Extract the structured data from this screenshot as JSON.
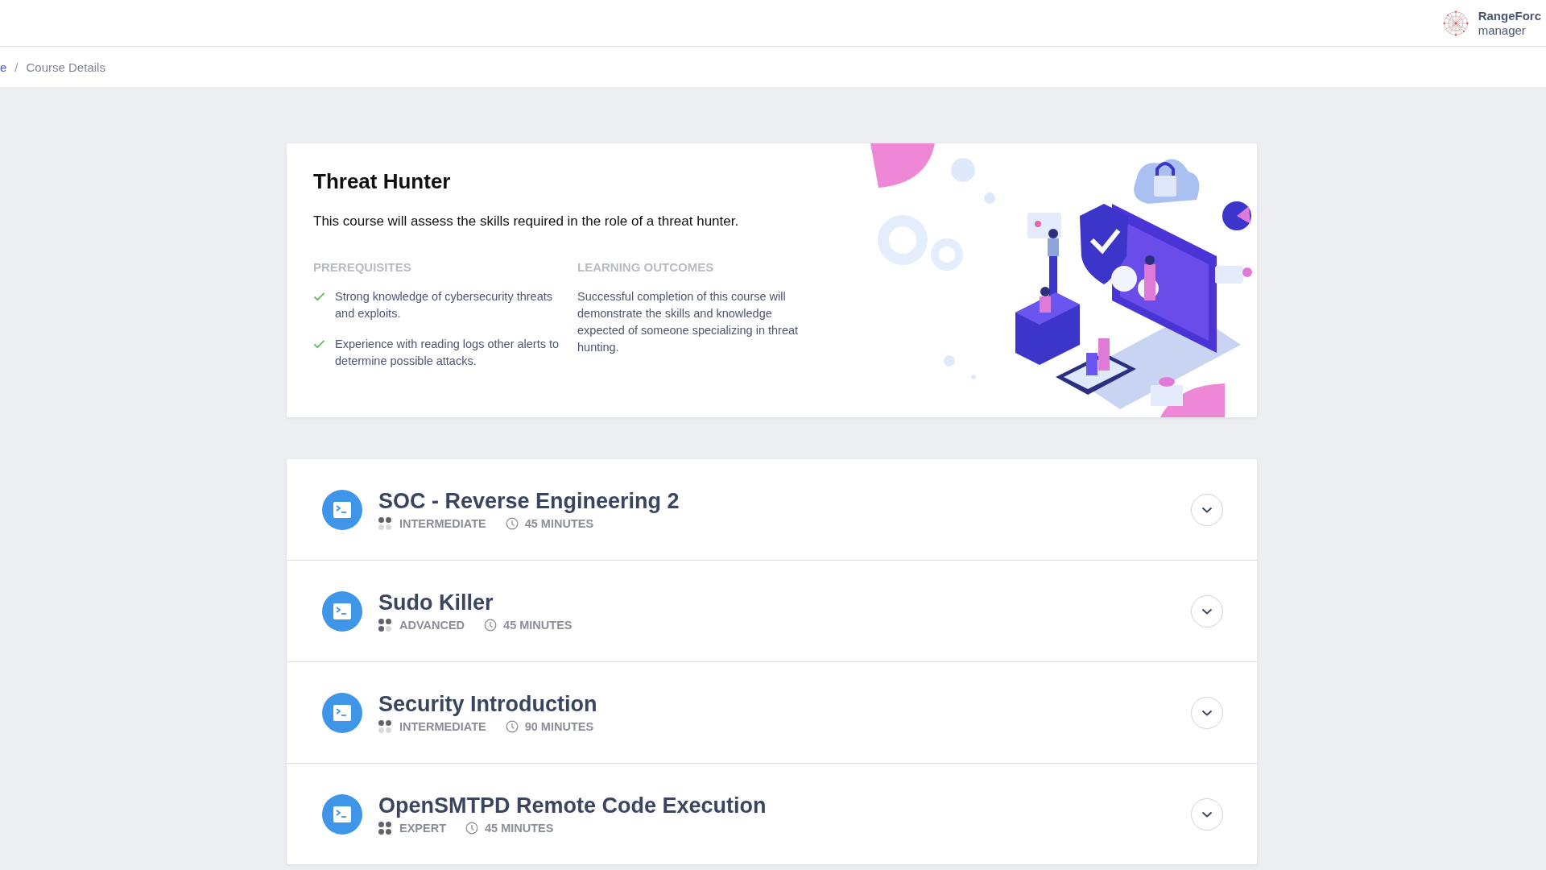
{
  "header": {
    "org": "RangeForc",
    "role": "manager"
  },
  "breadcrumb": [
    {
      "label": "e",
      "kind": "link"
    },
    {
      "label": "/",
      "kind": "separator"
    },
    {
      "label": "Course Details",
      "kind": "current"
    }
  ],
  "course": {
    "title": "Threat Hunter",
    "description": "This course will assess the skills required in the role of a threat hunter.",
    "prerequisites": {
      "heading": "PREREQUISITES",
      "items": [
        "Strong knowledge of cybersecurity threats and exploits.",
        "Experience with reading logs other alerts to determine possible attacks."
      ]
    },
    "outcomes": {
      "heading": "LEARNING OUTCOMES",
      "text": "Successful completion of this course will demonstrate the skills and knowledge expected of someone specializing in threat hunting."
    }
  },
  "modules": [
    {
      "title": "SOC - Reverse Engineering 2",
      "difficulty": "INTERMEDIATE",
      "difficulty_dots": [
        {
          "filled": true
        },
        {
          "filled": true
        },
        {
          "filled": false
        },
        {
          "filled": false
        }
      ],
      "duration": "45 MINUTES",
      "expanded": false
    },
    {
      "title": "Sudo Killer",
      "difficulty": "ADVANCED",
      "difficulty_dots": [
        {
          "filled": true
        },
        {
          "filled": true
        },
        {
          "filled": true
        },
        {
          "filled": false
        }
      ],
      "duration": "45 MINUTES",
      "expanded": false
    },
    {
      "title": "Security Introduction",
      "difficulty": "INTERMEDIATE",
      "difficulty_dots": [
        {
          "filled": true
        },
        {
          "filled": true
        },
        {
          "filled": false
        },
        {
          "filled": false
        }
      ],
      "duration": "90 MINUTES",
      "expanded": false
    },
    {
      "title": "OpenSMTPD Remote Code Execution",
      "difficulty": "EXPERT",
      "difficulty_dots": [
        {
          "filled": true
        },
        {
          "filled": true
        },
        {
          "filled": true
        },
        {
          "filled": true
        }
      ],
      "duration": "45 MINUTES",
      "expanded": false
    }
  ]
}
